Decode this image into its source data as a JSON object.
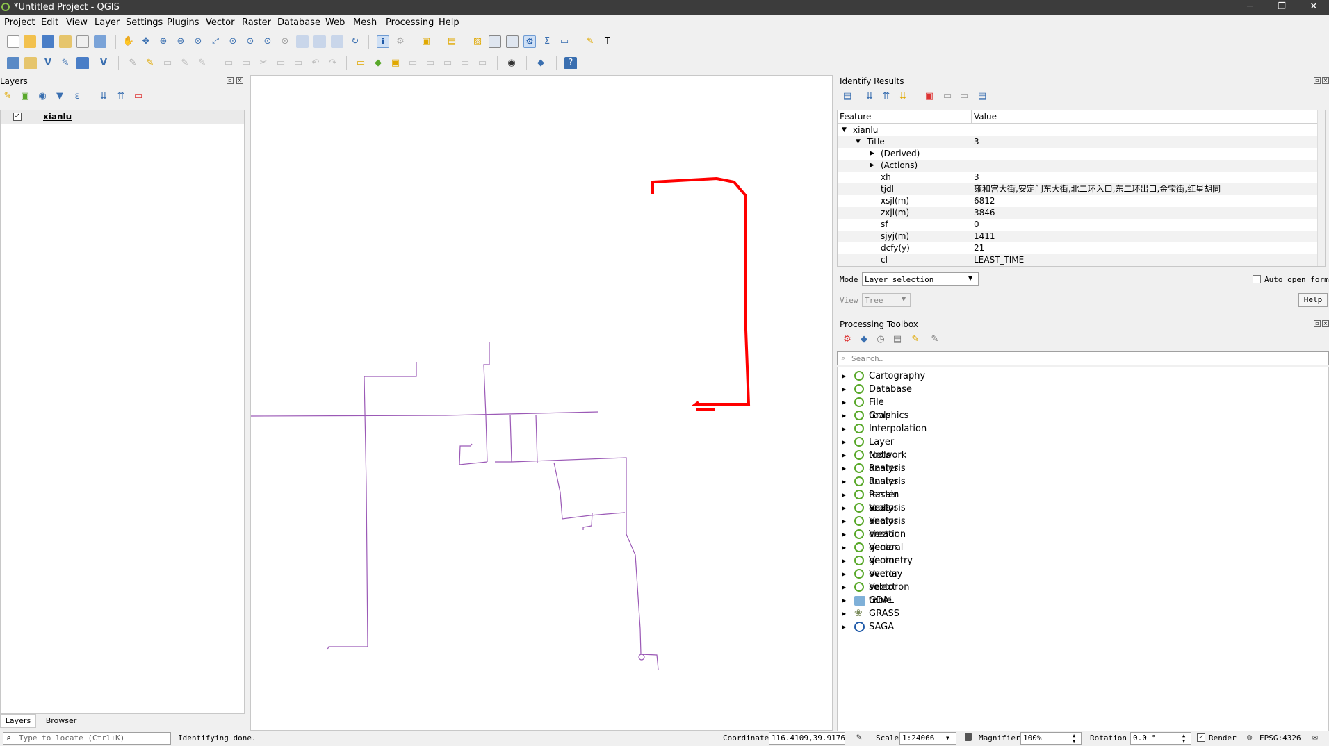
{
  "window": {
    "title": "*Untitled Project - QGIS",
    "minimize": "─",
    "maximize": "❐",
    "close": "✕"
  },
  "menu": [
    "Project",
    "Edit",
    "View",
    "Layer",
    "Settings",
    "Plugins",
    "Vector",
    "Raster",
    "Database",
    "Web",
    "Mesh",
    "Processing",
    "Help"
  ],
  "layers_panel": {
    "title": "Layers",
    "layer": {
      "name": "xianlu",
      "checked": "✓"
    },
    "tabs": [
      "Layers",
      "Browser"
    ]
  },
  "identify": {
    "title": "Identify Results",
    "columns": [
      "Feature",
      "Value"
    ],
    "layer_name": "xianlu",
    "title_row": {
      "key": "Title",
      "value": "3"
    },
    "derived": "(Derived)",
    "actions": "(Actions)",
    "attributes": [
      {
        "key": "xh",
        "value": "3"
      },
      {
        "key": "tjdl",
        "value": "雍和宫大街,安定门东大街,北二环入口,东二环出口,金宝街,红星胡同"
      },
      {
        "key": "xsjl(m)",
        "value": "6812"
      },
      {
        "key": "zxjl(m)",
        "value": "3846"
      },
      {
        "key": "sf",
        "value": "0"
      },
      {
        "key": "sjyj(m)",
        "value": "1411"
      },
      {
        "key": "dcfy(y)",
        "value": "21"
      },
      {
        "key": "cl",
        "value": "LEAST_TIME"
      }
    ],
    "mode_label": "Mode",
    "mode_value": "Layer selection",
    "view_label": "View",
    "view_value": "Tree",
    "auto_open_label": "Auto open form",
    "help_label": "Help"
  },
  "toolbox": {
    "title": "Processing Toolbox",
    "search_placeholder": "Search…",
    "groups": [
      "Cartography",
      "Database",
      "File tools",
      "Graphics",
      "Interpolation",
      "Layer tools",
      "Network analysis",
      "Raster analysis",
      "Raster terrain analysis",
      "Raster tools",
      "Vector analysis",
      "Vector creation",
      "Vector general",
      "Vector geometry",
      "Vector overlay",
      "Vector selection",
      "Vector table"
    ],
    "providers": [
      "GDAL",
      "GRASS",
      "SAGA"
    ]
  },
  "status": {
    "locate_placeholder": "Type to locate (Ctrl+K)",
    "message": "Identifying done.",
    "coordinate_label": "Coordinate",
    "coordinate_value": "116.4109,39.9176",
    "scale_label": "Scale",
    "scale_value": "1:24066",
    "magnifier_label": "Magnifier",
    "magnifier_value": "100%",
    "rotation_label": "Rotation",
    "rotation_value": "0.0 °",
    "render_label": "Render",
    "crs": "EPSG:4326"
  },
  "colors": {
    "selected_feature": "#ff0000",
    "layer_line": "#9b59b6",
    "qgis_green": "#59a82a"
  }
}
